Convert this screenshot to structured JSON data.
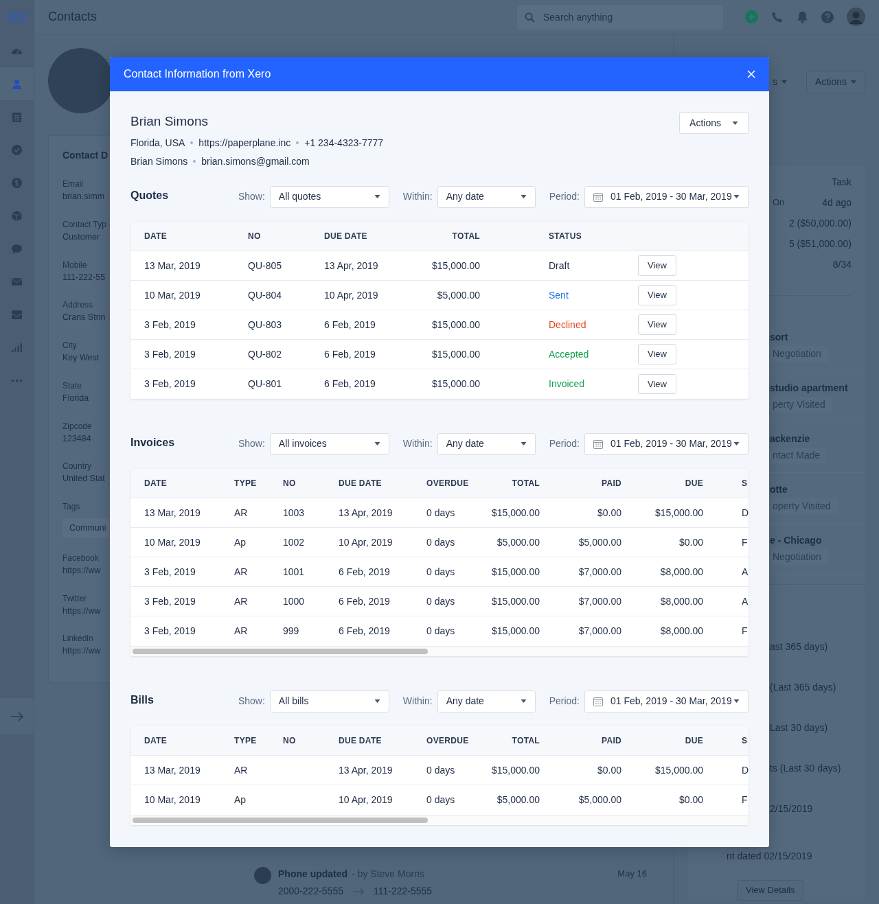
{
  "top_bar": {
    "title": "Contacts",
    "search": {
      "placeholder": "Search anything"
    }
  },
  "sidebar": {
    "items": [
      {
        "kind": "gauge",
        "selected": false
      },
      {
        "kind": "person",
        "selected": true
      },
      {
        "kind": "calendar",
        "selected": false
      },
      {
        "kind": "check",
        "selected": false
      },
      {
        "kind": "dollar",
        "selected": false
      },
      {
        "kind": "box",
        "selected": false
      },
      {
        "kind": "chat",
        "selected": false
      },
      {
        "kind": "mail",
        "selected": false
      },
      {
        "kind": "inbox",
        "selected": false
      },
      {
        "kind": "chart",
        "selected": false
      },
      {
        "kind": "more",
        "selected": false
      }
    ]
  },
  "contact_details": {
    "title": "Contact D",
    "fields": [
      {
        "kind": "text",
        "label": "Email",
        "value": "brian.simm"
      },
      {
        "kind": "text",
        "label": "Contact Typ",
        "value": "Customer"
      },
      {
        "kind": "text",
        "label": "Mobile",
        "value": "111-222-55"
      },
      {
        "kind": "text",
        "label": "Address",
        "value": "Crans Strin"
      },
      {
        "kind": "text",
        "label": "City",
        "value": "Key West"
      },
      {
        "kind": "text",
        "label": "State",
        "value": "Florida"
      },
      {
        "kind": "text",
        "label": "Zipcode",
        "value": "123484"
      },
      {
        "kind": "text",
        "label": "Country",
        "value": "United Stat"
      },
      {
        "kind": "tag",
        "label": "Tags",
        "value": "Communi"
      },
      {
        "kind": "text",
        "label": "Facebook",
        "value": "https://ww"
      },
      {
        "kind": "text",
        "label": "Twitter",
        "value": "https://ww"
      },
      {
        "kind": "text",
        "label": "Linkedin",
        "value": "https://ww"
      }
    ]
  },
  "page_header": {
    "dropdown": "s",
    "actions": "Actions"
  },
  "summary": [
    {
      "value": "Task"
    },
    {
      "label": "On",
      "value": "4d ago"
    },
    {
      "value": "2 ($50,000.00)"
    },
    {
      "value": "5 ($51,000.00)"
    },
    {
      "value": "8/34"
    }
  ],
  "deals": [
    {
      "name": "sort",
      "stage": "Negotiation"
    },
    {
      "name": "studio apartment",
      "stage": "perty Visited"
    },
    {
      "name": "ackenzie",
      "stage": "ntact Made"
    },
    {
      "name": "otte",
      "stage": "operty Visited"
    },
    {
      "name": "e - Chicago",
      "stage": "Negotiation"
    }
  ],
  "stats": [
    "ast 365 days)",
    "(Last 365 days)",
    "Last 30 days)",
    "ts (Last 30 days)",
    "2/15/2019",
    "nt dated 02/15/2019"
  ],
  "view_details": "View Details",
  "activity": {
    "title": "Phone updated",
    "by": "- by Steve Morris",
    "date": "May 16",
    "from": "2000-222-5555",
    "to": "111-222-5555"
  },
  "modal": {
    "title": "Contact Information from Xero",
    "name": "Brian Simons",
    "meta": [
      [
        "Florida, USA",
        "https://paperplane.inc",
        "+1 234-4323-7777"
      ],
      [
        "Brian Simons",
        "brian.simons@gmail.com"
      ]
    ],
    "actions": "Actions",
    "sections": [
      {
        "kind": "quotes",
        "title": "Quotes",
        "filters": [
          {
            "kind": "select",
            "label": "Show:",
            "value": "All quotes"
          },
          {
            "kind": "select",
            "label": "Within:",
            "value": "Any date"
          },
          {
            "kind": "date_range",
            "label": "Period:",
            "value": "01 Feb, 2019 - 30 Mar, 2019"
          }
        ],
        "columns": [
          {
            "label": "DATE"
          },
          {
            "label": "NO"
          },
          {
            "label": "DUE DATE"
          },
          {
            "label": "TOTAL"
          },
          {
            "label": "STATUS"
          }
        ],
        "rows": [
          {
            "cells": [
              "13 Mar, 2019",
              "QU-805",
              "13 Apr, 2019",
              "$15,000.00"
            ],
            "status": {
              "text": "Draft",
              "color": "#1e2d45"
            },
            "action": "View"
          },
          {
            "cells": [
              "10 Mar, 2019",
              "QU-804",
              "10 Apr, 2019",
              "$5,000.00"
            ],
            "status": {
              "text": "Sent",
              "color": "#1a73e8"
            },
            "action": "View"
          },
          {
            "cells": [
              "3 Feb, 2019",
              "QU-803",
              "6 Feb, 2019",
              "$15,000.00"
            ],
            "status": {
              "text": "Declined",
              "color": "#e5461c"
            },
            "action": "View"
          },
          {
            "cells": [
              "3 Feb, 2019",
              "QU-802",
              "6 Feb, 2019",
              "$15,000.00"
            ],
            "status": {
              "text": "Accepted",
              "color": "#12a150"
            },
            "action": "View"
          },
          {
            "cells": [
              "3 Feb, 2019",
              "QU-801",
              "6 Feb, 2019",
              "$15,000.00"
            ],
            "status": {
              "text": "Invoiced",
              "color": "#12a150"
            },
            "action": "View"
          }
        ]
      },
      {
        "kind": "ledger",
        "title": "Invoices",
        "filters": [
          {
            "kind": "select",
            "label": "Show:",
            "value": "All invoices"
          },
          {
            "kind": "select",
            "label": "Within:",
            "value": "Any date"
          },
          {
            "kind": "date_range",
            "label": "Period:",
            "value": "01 Feb, 2019 - 30 Mar, 2019"
          }
        ],
        "columns": [
          {
            "label": "DATE"
          },
          {
            "label": "TYPE"
          },
          {
            "label": "NO"
          },
          {
            "label": "DUE DATE"
          },
          {
            "label": "OVERDUE"
          },
          {
            "label": "TOTAL"
          },
          {
            "label": "PAID"
          },
          {
            "label": "DUE"
          },
          {
            "label": "S"
          }
        ],
        "rows": [
          {
            "cells": [
              "13 Mar, 2019",
              "AR",
              "1003",
              "13 Apr, 2019",
              "0 days",
              "$15,000.00",
              "$0.00",
              "$15,000.00",
              "D"
            ]
          },
          {
            "cells": [
              "10 Mar, 2019",
              "Ap",
              "1002",
              "10 Apr, 2019",
              "0 days",
              "$5,000.00",
              "$5,000.00",
              "$0.00",
              "F"
            ]
          },
          {
            "cells": [
              "3 Feb, 2019",
              "AR",
              "1001",
              "6 Feb, 2019",
              "0 days",
              "$15,000.00",
              "$7,000.00",
              "$8,000.00",
              "A"
            ]
          },
          {
            "cells": [
              "3 Feb, 2019",
              "AR",
              "1000",
              "6 Feb, 2019",
              "0 days",
              "$15,000.00",
              "$7,000.00",
              "$8,000.00",
              "A"
            ]
          },
          {
            "cells": [
              "3 Feb, 2019",
              "AR",
              "999",
              "6 Feb, 2019",
              "0 days",
              "$15,000.00",
              "$7,000.00",
              "$8,000.00",
              "F"
            ]
          }
        ]
      },
      {
        "kind": "ledger",
        "title": "Bills",
        "filters": [
          {
            "kind": "select",
            "label": "Show:",
            "value": "All bills"
          },
          {
            "kind": "select",
            "label": "Within:",
            "value": "Any date"
          },
          {
            "kind": "date_range",
            "label": "Period:",
            "value": "01 Feb, 2019 - 30 Mar, 2019"
          }
        ],
        "columns": [
          {
            "label": "DATE"
          },
          {
            "label": "TYPE"
          },
          {
            "label": "NO"
          },
          {
            "label": "DUE DATE"
          },
          {
            "label": "OVERDUE"
          },
          {
            "label": "TOTAL"
          },
          {
            "label": "PAID"
          },
          {
            "label": "DUE"
          },
          {
            "label": "S"
          }
        ],
        "rows": [
          {
            "cells": [
              "13 Mar, 2019",
              "AR",
              "",
              "13 Apr, 2019",
              "0 days",
              "$15,000.00",
              "$0.00",
              "$15,000.00",
              "D"
            ]
          },
          {
            "cells": [
              "10 Mar, 2019",
              "Ap",
              "",
              "10 Apr, 2019",
              "0 days",
              "$5,000.00",
              "$5,000.00",
              "$0.00",
              "F"
            ]
          }
        ]
      }
    ]
  }
}
